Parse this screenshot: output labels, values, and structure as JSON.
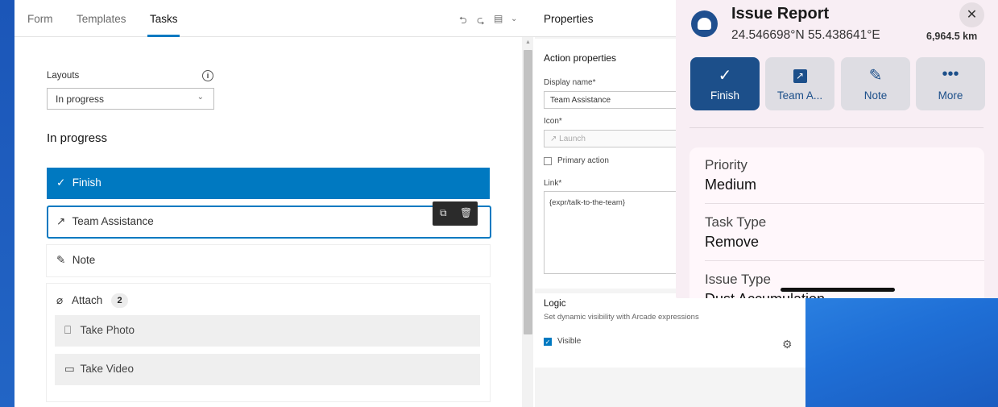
{
  "builder": {
    "tabs": [
      "Form",
      "Templates",
      "Tasks"
    ],
    "active_tab": "Tasks",
    "toolbar_icons": [
      "undo-icon",
      "redo-icon",
      "save-icon",
      "chevron-down-icon"
    ],
    "layouts_label": "Layouts",
    "layouts_value": "In progress",
    "section_title": "In progress",
    "actions": {
      "finish": "Finish",
      "team": "Team Assistance",
      "note": "Note",
      "attach": "Attach",
      "attach_count": "2",
      "take_photo": "Take Photo",
      "take_video": "Take Video"
    },
    "accent_color": "#0079c1"
  },
  "properties": {
    "header": "Properties",
    "section": "Action properties",
    "display_name_label": "Display name*",
    "display_name_value": "Team Assistance",
    "icon_label": "Icon*",
    "icon_value": "Launch",
    "primary_action_label": "Primary action",
    "primary_action_checked": false,
    "link_label": "Link*",
    "link_value": "{expr/talk-to-the-team}",
    "logic_title": "Logic",
    "logic_desc": "Set dynamic visibility with Arcade expressions",
    "visible_label": "Visible",
    "visible_checked": true
  },
  "sheet": {
    "title": "Issue Report",
    "coords": "24.546698°N  55.438641°E",
    "distance": "6,964.5 km",
    "close": "✕",
    "buttons": [
      {
        "label": "Finish",
        "icon": "checkmark-icon"
      },
      {
        "label": "Team A...",
        "icon": "launch-icon"
      },
      {
        "label": "Note",
        "icon": "pencil-icon"
      },
      {
        "label": "More",
        "icon": "ellipsis-icon"
      }
    ],
    "fields": [
      {
        "label": "Priority",
        "value": "Medium"
      },
      {
        "label": "Task Type",
        "value": "Remove"
      },
      {
        "label": "Issue Type",
        "value": "Dust Accumulation"
      }
    ],
    "primary_color": "#1c4f8a"
  }
}
